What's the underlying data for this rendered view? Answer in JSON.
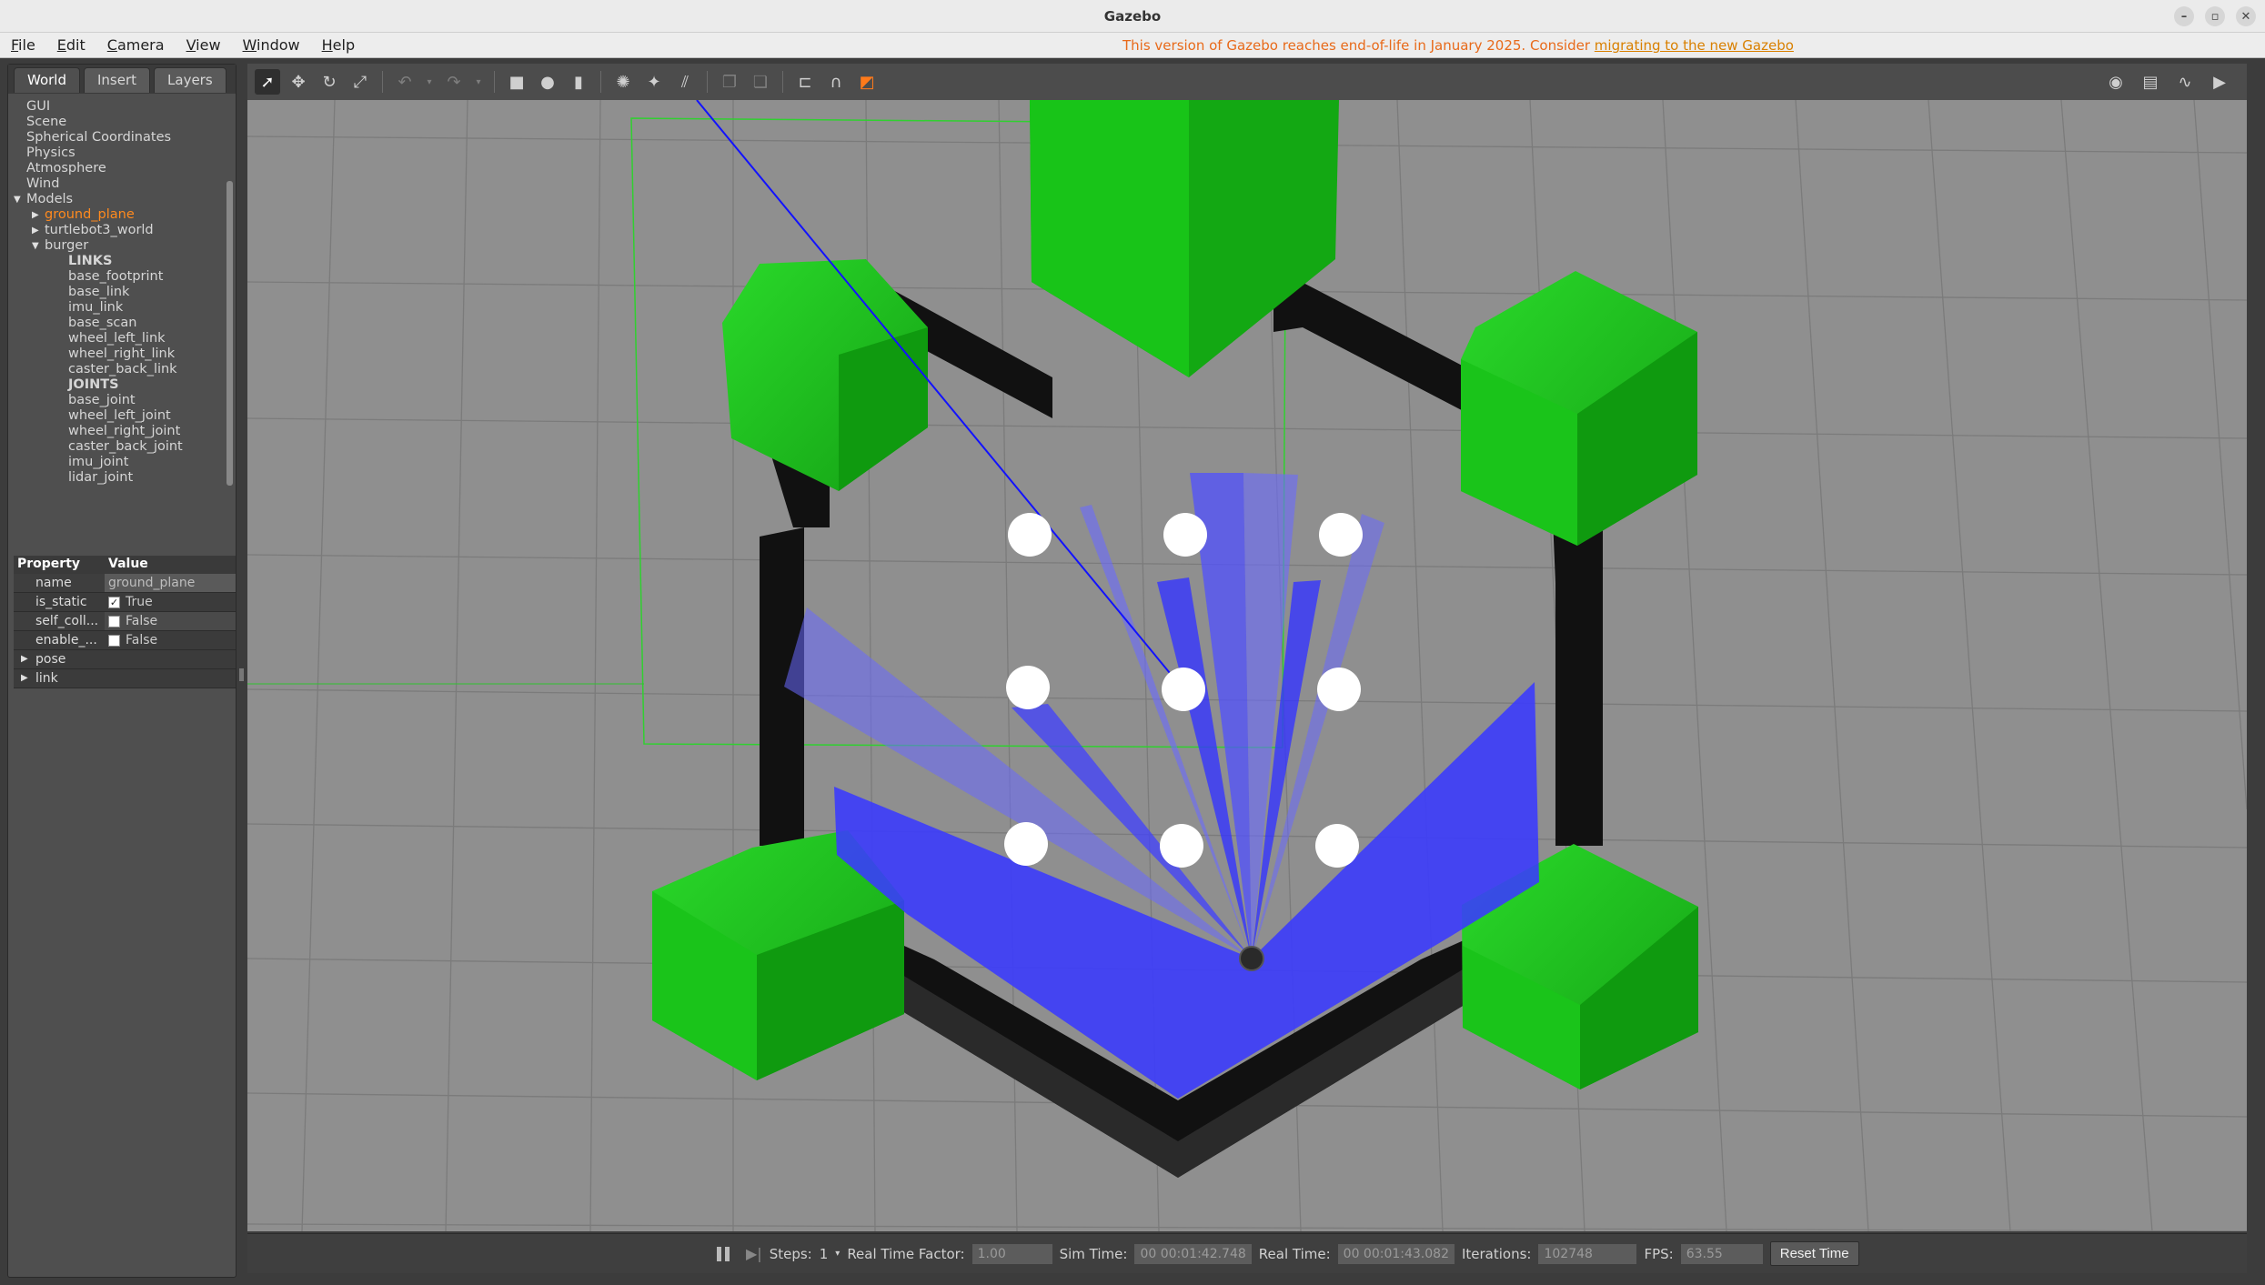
{
  "window": {
    "title": "Gazebo",
    "controls": [
      "–",
      "▫",
      "✕"
    ]
  },
  "menu": {
    "items": [
      "File",
      "Edit",
      "Camera",
      "View",
      "Window",
      "Help"
    ],
    "notice_text": "This version of Gazebo reaches end-of-life in January 2025. Consider ",
    "notice_link": "migrating to the new Gazebo"
  },
  "left_panel": {
    "tabs": [
      "World",
      "Insert",
      "Layers"
    ],
    "tree": [
      {
        "label": "GUI",
        "indent": 0
      },
      {
        "label": "Scene",
        "indent": 0
      },
      {
        "label": "Spherical Coordinates",
        "indent": 0
      },
      {
        "label": "Physics",
        "indent": 0
      },
      {
        "label": "Atmosphere",
        "indent": 0
      },
      {
        "label": "Wind",
        "indent": 0
      },
      {
        "label": "Models",
        "indent": 0,
        "arrow": "▼"
      },
      {
        "label": "ground_plane",
        "indent": 1,
        "arrow": "▶",
        "selected": true
      },
      {
        "label": "turtlebot3_world",
        "indent": 1,
        "arrow": "▶"
      },
      {
        "label": "burger",
        "indent": 1,
        "arrow": "▼"
      },
      {
        "label": "LINKS",
        "indent": 2,
        "bold": true
      },
      {
        "label": "base_footprint",
        "indent": 2
      },
      {
        "label": "base_link",
        "indent": 2
      },
      {
        "label": "imu_link",
        "indent": 2
      },
      {
        "label": "base_scan",
        "indent": 2
      },
      {
        "label": "wheel_left_link",
        "indent": 2
      },
      {
        "label": "wheel_right_link",
        "indent": 2
      },
      {
        "label": "caster_back_link",
        "indent": 2
      },
      {
        "label": "JOINTS",
        "indent": 2,
        "bold": true
      },
      {
        "label": "base_joint",
        "indent": 2
      },
      {
        "label": "wheel_left_joint",
        "indent": 2
      },
      {
        "label": "wheel_right_joint",
        "indent": 2
      },
      {
        "label": "caster_back_joint",
        "indent": 2
      },
      {
        "label": "imu_joint",
        "indent": 2
      },
      {
        "label": "lidar_joint",
        "indent": 2
      }
    ],
    "properties": {
      "header_property": "Property",
      "header_value": "Value",
      "name_key": "name",
      "name_value": "ground_plane",
      "static_key": "is_static",
      "static_value": "True",
      "self_key": "self_coll...",
      "self_value": "False",
      "enable_key": "enable_...",
      "enable_value": "False",
      "pose_label": "pose",
      "link_label": "link"
    }
  },
  "toolbar": {
    "icons": [
      "select-arrow-icon",
      "translate-icon",
      "rotate-icon",
      "scale-icon",
      "undo-icon",
      "redo-icon",
      "box-icon",
      "sphere-icon",
      "cylinder-icon",
      "point-light-icon",
      "spot-light-icon",
      "directional-light-icon",
      "copy-icon",
      "paste-icon",
      "align-icon",
      "snap-icon",
      "view-angle-icon"
    ],
    "right_icons": [
      "screenshot-icon",
      "log-icon",
      "plot-icon",
      "record-icon"
    ]
  },
  "bottom_bar": {
    "steps_label": "Steps:",
    "steps_value": "1",
    "rtf_label": "Real Time Factor:",
    "rtf_value": "1.00",
    "sim_time_label": "Sim Time:",
    "sim_time_value": "00 00:01:42.748",
    "real_time_label": "Real Time:",
    "real_time_value": "00 00:01:43.082",
    "iterations_label": "Iterations:",
    "iterations_value": "102748",
    "fps_label": "FPS:",
    "fps_value": "63.55",
    "reset_label": "Reset Time"
  },
  "colors": {
    "ground": "#8f8f8f",
    "obstacle_green": "#1fbf1f",
    "wall_black": "#141414",
    "laser_blue": "#3030ff",
    "selected_orange": "#ff8a1e"
  }
}
